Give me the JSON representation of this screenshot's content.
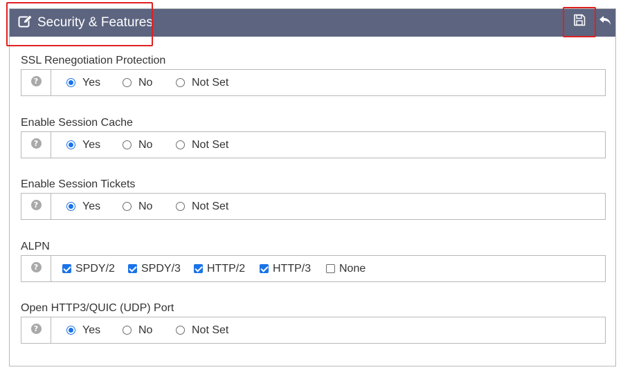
{
  "header": {
    "title": "Security & Features",
    "background": "#5c6480",
    "icons": [
      "edit-icon",
      "save-icon",
      "undo-icon"
    ]
  },
  "fields": [
    {
      "label": "SSL Renegotiation Protection",
      "type": "radio",
      "options": [
        "Yes",
        "No",
        "Not Set"
      ],
      "selected": "Yes"
    },
    {
      "label": "Enable Session Cache",
      "type": "radio",
      "options": [
        "Yes",
        "No",
        "Not Set"
      ],
      "selected": "Yes"
    },
    {
      "label": "Enable Session Tickets",
      "type": "radio",
      "options": [
        "Yes",
        "No",
        "Not Set"
      ],
      "selected": "Yes"
    },
    {
      "label": "ALPN",
      "type": "checkbox",
      "options": [
        "SPDY/2",
        "SPDY/3",
        "HTTP/2",
        "HTTP/3",
        "None"
      ],
      "checked": [
        "SPDY/2",
        "SPDY/3",
        "HTTP/2",
        "HTTP/3"
      ]
    },
    {
      "label": "Open HTTP3/QUIC (UDP) Port",
      "type": "radio",
      "options": [
        "Yes",
        "No",
        "Not Set"
      ],
      "selected": "Yes"
    }
  ],
  "help_icon_glyph": "?",
  "accent_color": "#1a73e8",
  "highlight_color": "#e02020"
}
